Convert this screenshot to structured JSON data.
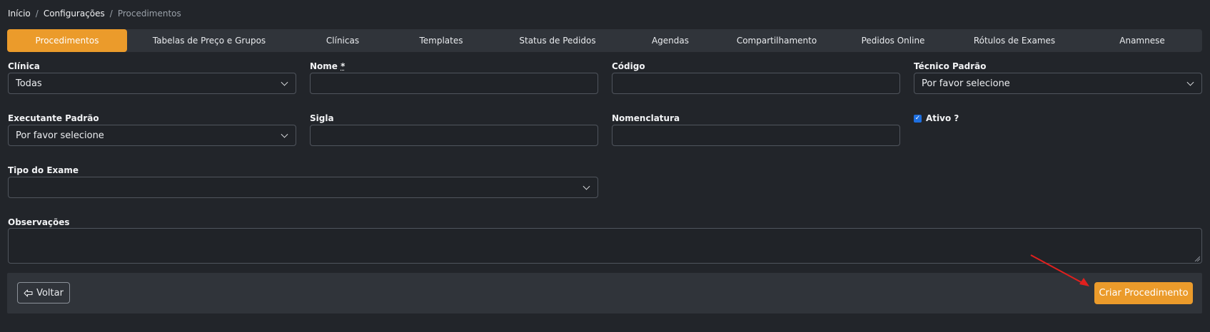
{
  "breadcrumb": {
    "home": "Início",
    "config": "Configurações",
    "current": "Procedimentos",
    "separator": "/"
  },
  "tabs": [
    {
      "label": "Procedimentos",
      "active": true
    },
    {
      "label": "Tabelas de Preço e Grupos"
    },
    {
      "label": "Clínicas"
    },
    {
      "label": "Templates"
    },
    {
      "label": "Status de Pedidos"
    },
    {
      "label": "Agendas"
    },
    {
      "label": "Compartilhamento"
    },
    {
      "label": "Pedidos Online"
    },
    {
      "label": "Rótulos de Exames"
    },
    {
      "label": "Anamnese"
    }
  ],
  "form": {
    "clinica": {
      "label": "Clínica",
      "value": "Todas"
    },
    "nome": {
      "label": "Nome",
      "required_mark": "*",
      "value": ""
    },
    "codigo": {
      "label": "Código",
      "value": ""
    },
    "tecnico": {
      "label": "Técnico Padrão",
      "value": "Por favor selecione"
    },
    "executante": {
      "label": "Executante Padrão",
      "value": "Por favor selecione"
    },
    "sigla": {
      "label": "Sigla",
      "value": ""
    },
    "nomenclatura": {
      "label": "Nomenclatura",
      "value": ""
    },
    "ativo": {
      "label": "Ativo ?",
      "checked": true
    },
    "tipo_exame": {
      "label": "Tipo do Exame",
      "value": ""
    },
    "observacoes": {
      "label": "Observações",
      "value": ""
    }
  },
  "footer": {
    "back_label": "Voltar",
    "back_icon": "arrow-left-icon",
    "create_label": "Criar Procedimento"
  },
  "colors": {
    "accent": "#eb9b2b",
    "background": "#22252a",
    "annotation_arrow": "#e0201e"
  }
}
